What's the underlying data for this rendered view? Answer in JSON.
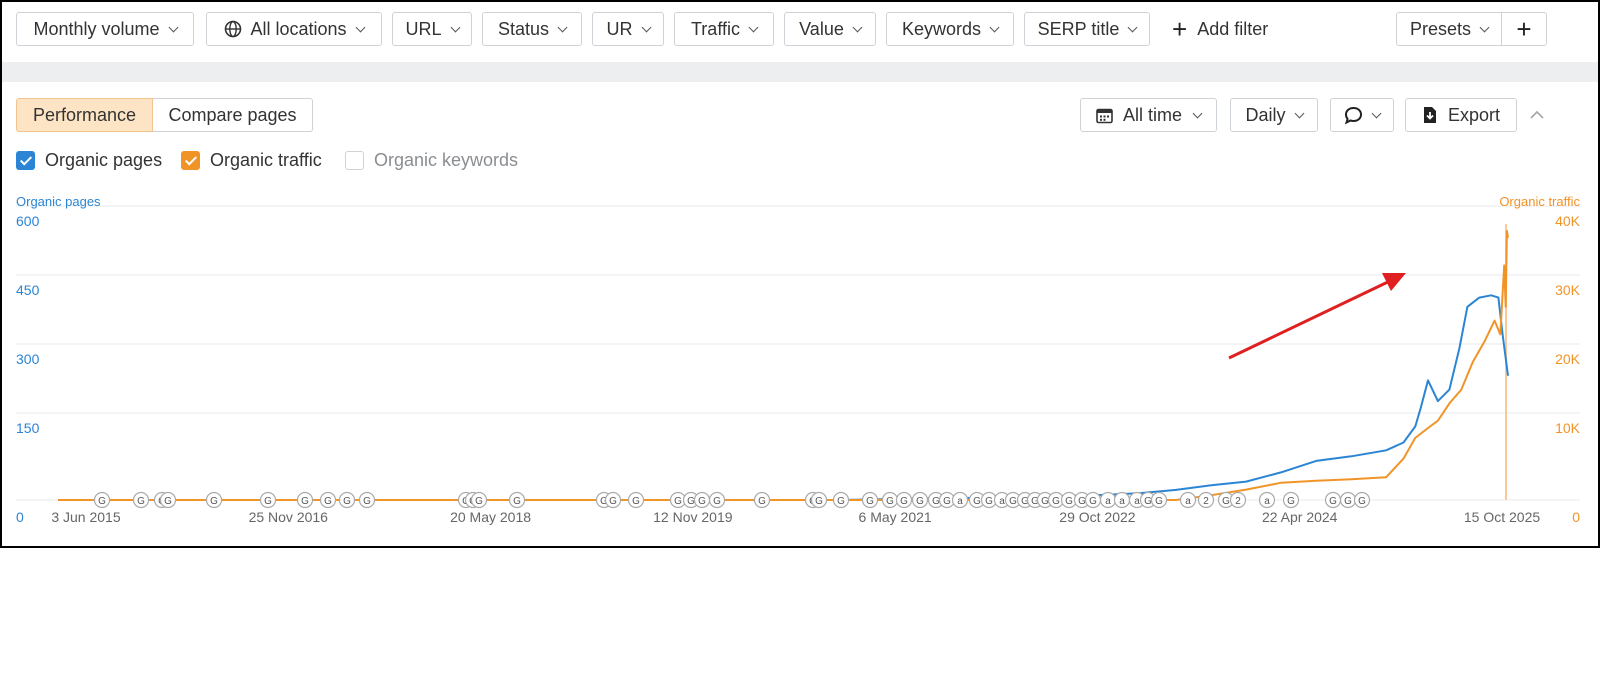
{
  "filters": [
    {
      "label": "Monthly volume",
      "has_chevron": true
    },
    {
      "label": "All locations",
      "has_chevron": true,
      "icon": "globe-icon"
    },
    {
      "label": "URL",
      "has_chevron": true
    },
    {
      "label": "Status",
      "has_chevron": true
    },
    {
      "label": "UR",
      "has_chevron": true
    },
    {
      "label": "Traffic",
      "has_chevron": true
    },
    {
      "label": "Value",
      "has_chevron": true
    },
    {
      "label": "Keywords",
      "has_chevron": true
    },
    {
      "label": "SERP title",
      "has_chevron": true
    }
  ],
  "add_filter": {
    "label": "Add filter",
    "icon": "plus-icon"
  },
  "presets": {
    "label": "Presets",
    "add_icon": "plus-icon"
  },
  "view_tabs": {
    "performance": "Performance",
    "compare": "Compare pages",
    "active": "performance"
  },
  "controls": {
    "time_range": "All time",
    "calendar_icon": "calendar-icon",
    "granularity": "Daily",
    "comment_icon": "comment-icon",
    "export": "Export",
    "export_icon": "download-icon",
    "collapse_icon": "chevron-up-icon"
  },
  "legend": [
    {
      "label": "Organic pages",
      "checked": true,
      "color": "#2b85d4"
    },
    {
      "label": "Organic traffic",
      "checked": true,
      "color": "#f19428"
    },
    {
      "label": "Organic keywords",
      "checked": false,
      "color": "#cfd2d6"
    }
  ],
  "colors": {
    "pages": "#2b85d4",
    "traffic": "#f19428",
    "annotation_arrow": "#e02020",
    "grid": "#e6e8eb"
  },
  "chart_data": {
    "type": "line",
    "left_axis": {
      "title": "Organic pages",
      "ticks": [
        "0",
        "150",
        "300",
        "450",
        "600"
      ],
      "range": [
        0,
        600
      ]
    },
    "right_axis": {
      "title": "Organic traffic",
      "ticks": [
        "0",
        "10K",
        "20K",
        "30K",
        "40K"
      ],
      "range": [
        0,
        40000
      ]
    },
    "x_ticks": [
      "3 Jun 2015",
      "25 Nov 2016",
      "20 May 2018",
      "12 Nov 2019",
      "6 May 2021",
      "29 Oct 2022",
      "22 Apr 2024",
      "15 Oct 2025"
    ],
    "x_range": [
      "2015-06-03",
      "2025-10-15"
    ],
    "grid": true,
    "series": [
      {
        "name": "Organic pages",
        "axis": "left",
        "color": "#2b85d4",
        "x": [
          "2015-06-03",
          "2021-01-01",
          "2022-01-01",
          "2022-10-29",
          "2023-03-01",
          "2023-06-01",
          "2023-09-01",
          "2023-12-01",
          "2024-03-01",
          "2024-06-01",
          "2024-09-01",
          "2024-12-01",
          "2025-01-15",
          "2025-02-15",
          "2025-03-01",
          "2025-03-20",
          "2025-04-15",
          "2025-05-15",
          "2025-06-10",
          "2025-07-01",
          "2025-08-01",
          "2025-09-01",
          "2025-09-20",
          "2025-10-01",
          "2025-10-15"
        ],
        "y": [
          0,
          0,
          5,
          10,
          15,
          22,
          32,
          40,
          60,
          85,
          95,
          108,
          125,
          160,
          200,
          260,
          215,
          240,
          330,
          420,
          440,
          445,
          440,
          360,
          270
        ]
      },
      {
        "name": "Organic traffic",
        "axis": "right",
        "color": "#f19428",
        "x": [
          "2015-06-03",
          "2023-06-01",
          "2023-09-01",
          "2023-12-01",
          "2024-03-01",
          "2024-06-01",
          "2024-09-01",
          "2024-12-01",
          "2025-01-15",
          "2025-02-15",
          "2025-03-10",
          "2025-04-15",
          "2025-05-15",
          "2025-06-15",
          "2025-07-15",
          "2025-08-15",
          "2025-09-10",
          "2025-09-25",
          "2025-10-05",
          "2025-10-09",
          "2025-10-12",
          "2025-10-15"
        ],
        "y": [
          0,
          0,
          700,
          1500,
          2500,
          2800,
          3000,
          3300,
          6000,
          9000,
          10000,
          11500,
          14000,
          16000,
          20000,
          23000,
          26000,
          24000,
          34000,
          28000,
          39000,
          38000
        ]
      }
    ],
    "annotation_markers": [
      "G",
      "G",
      "G",
      "G",
      "G",
      "G",
      "G",
      "G",
      "G",
      "G",
      "G",
      "G",
      "G",
      "G",
      "G",
      "G",
      "G",
      "G",
      "G",
      "G",
      "G",
      "G",
      "G",
      "G",
      "G",
      "G",
      "G",
      "G",
      "G",
      "G",
      "G",
      "a",
      "G",
      "G",
      "a",
      "G",
      "G",
      "G",
      "G",
      "G",
      "G",
      "G",
      "G",
      "a",
      "a",
      "a",
      "G",
      "G",
      "a",
      "2",
      "G",
      "2",
      "a",
      "G",
      "G",
      "G",
      "G"
    ]
  }
}
